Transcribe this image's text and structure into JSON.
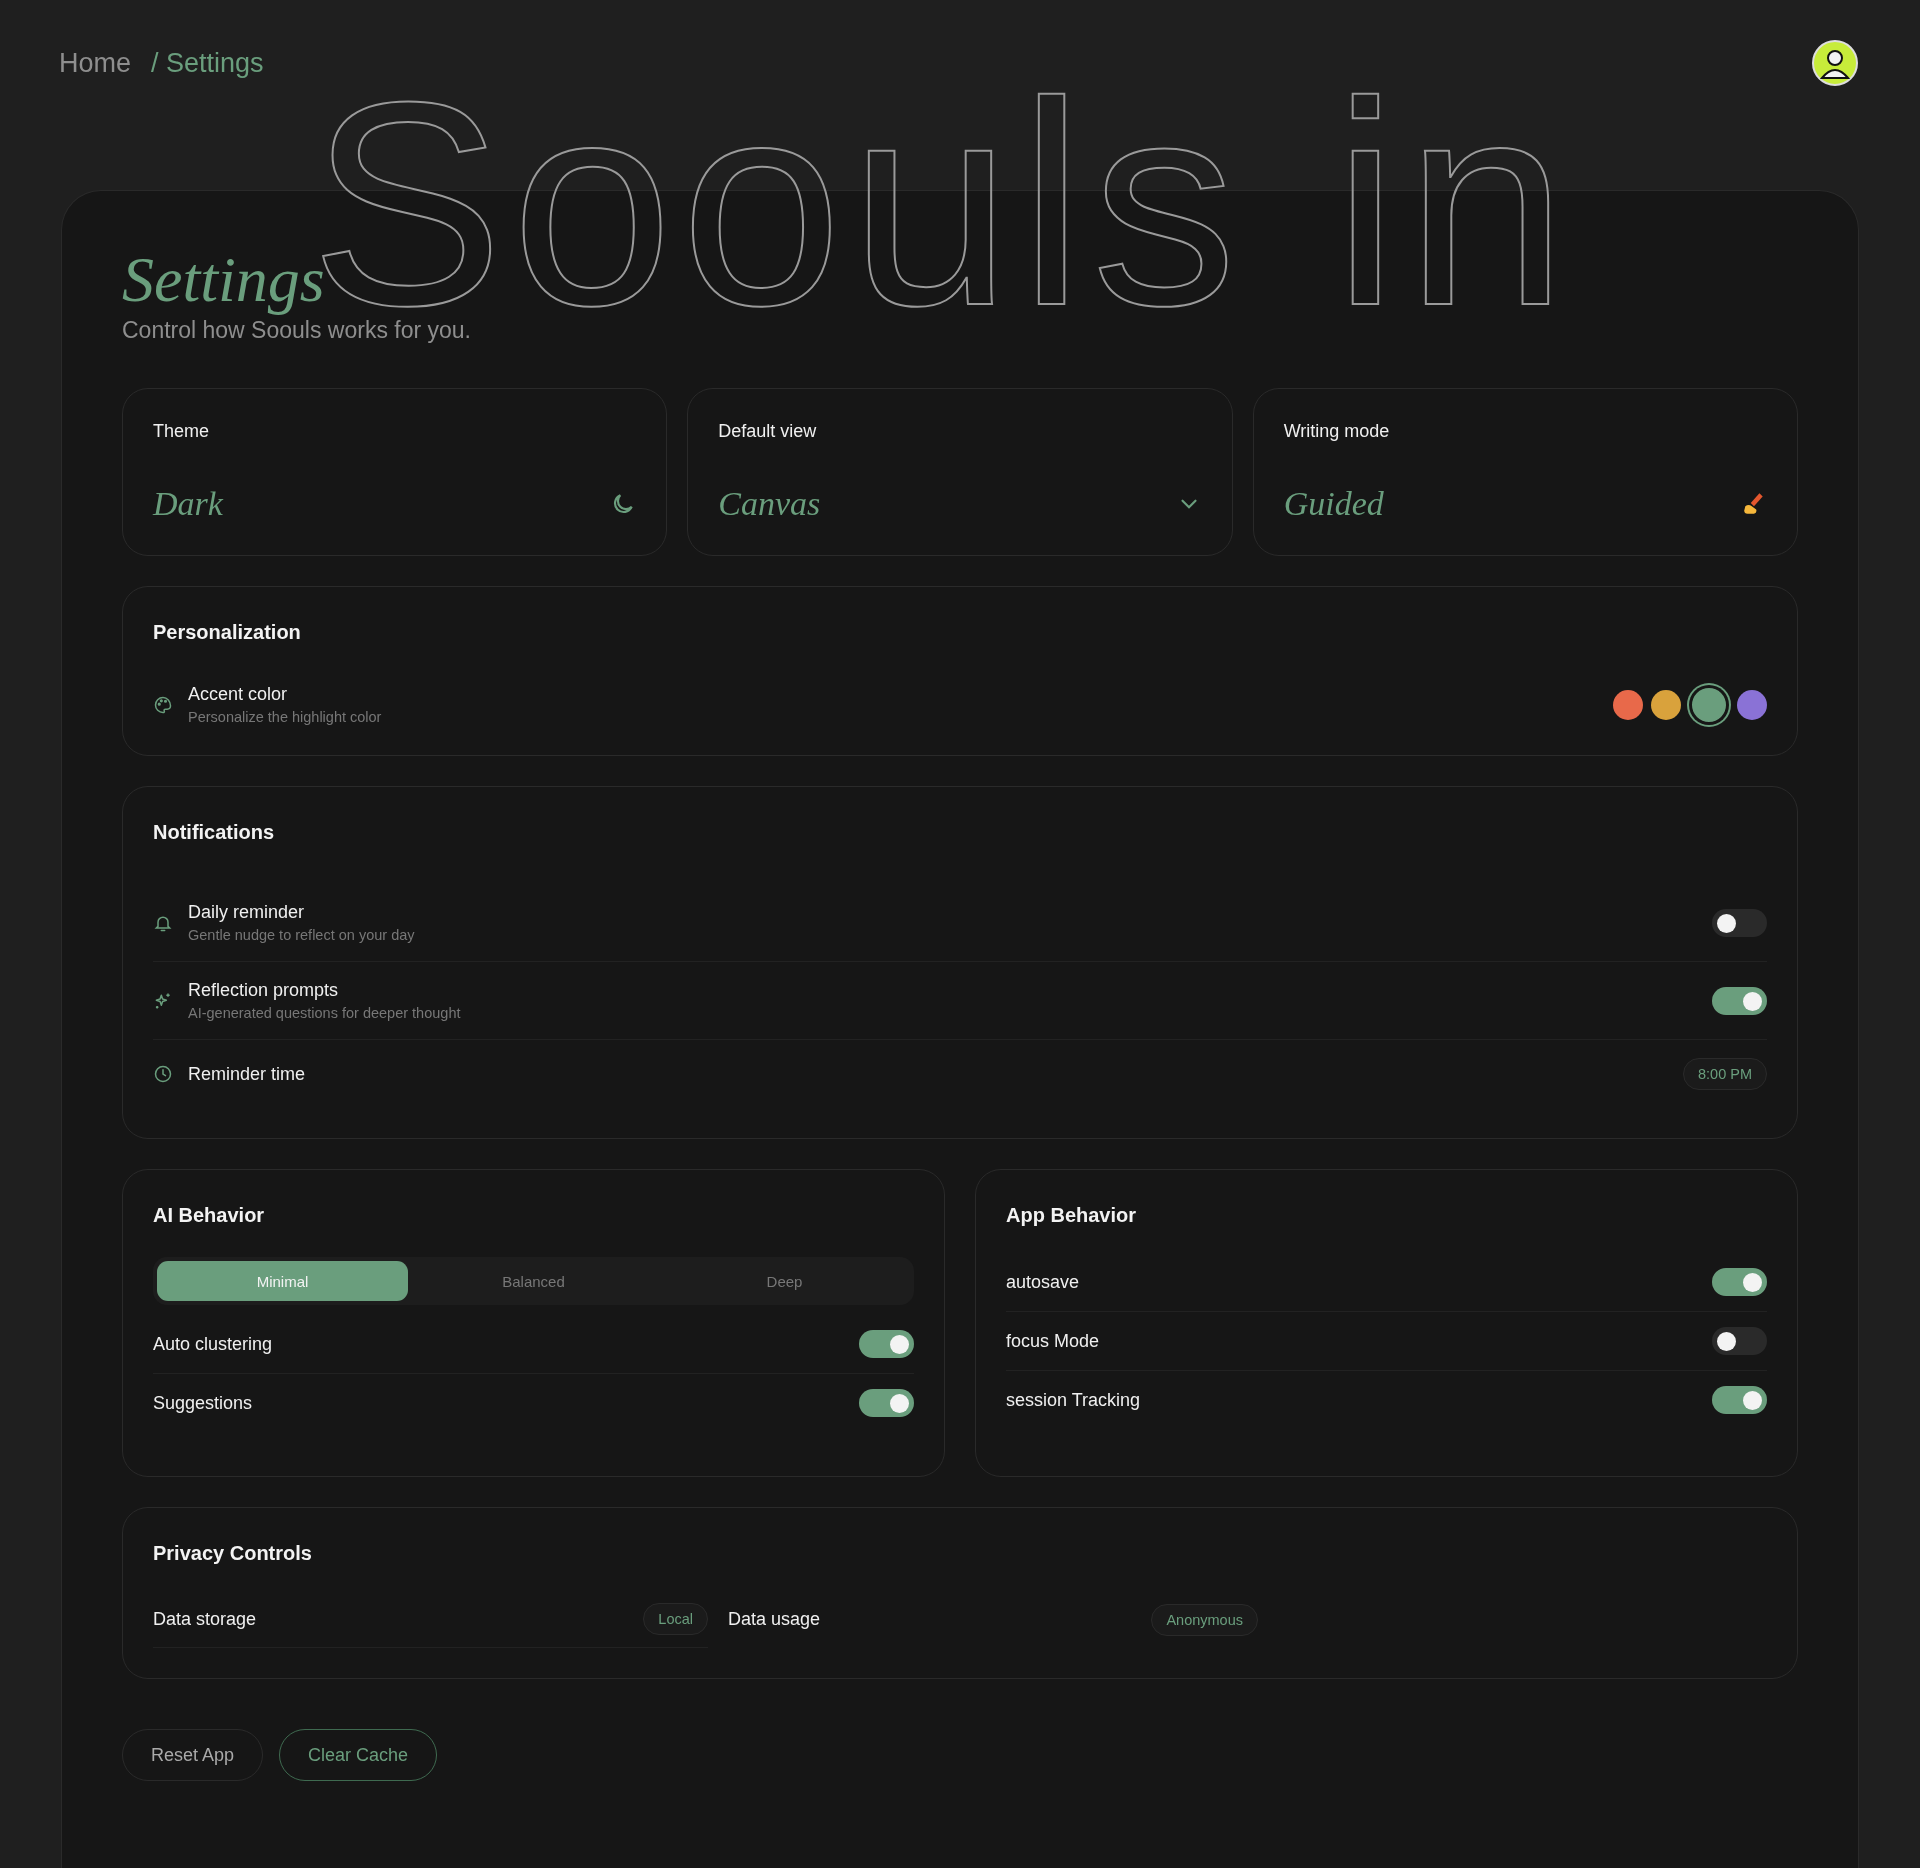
{
  "breadcrumb": [
    {
      "label": "Home",
      "current": false
    },
    {
      "label": "/ Settings",
      "current": true
    }
  ],
  "background_text": "Soouls in",
  "header": {
    "title": "Settings",
    "subtitle": "Control how Soouls works for you."
  },
  "quick_settings": [
    {
      "label": "Theme",
      "value": "Dark",
      "kind": "moon"
    },
    {
      "label": "Default view",
      "value": "Canvas",
      "kind": "dropdown"
    },
    {
      "label": "Writing mode",
      "value": "Guided",
      "kind": "hand"
    }
  ],
  "personalization": {
    "title": "Personalization",
    "label": "Accent color",
    "description": "Personalize the highlight color",
    "colors": [
      {
        "color": "#e8694a",
        "selected": false
      },
      {
        "color": "#d9a23c",
        "selected": false
      },
      {
        "color": "#6a9e7d",
        "selected": true
      },
      {
        "color": "#8a72d6",
        "selected": false
      }
    ]
  },
  "notifications": {
    "title": "Notifications",
    "rows": [
      {
        "kind": "toggle",
        "label": "Daily reminder",
        "description": "Gentle nudge to reflect on your day",
        "on": false
      },
      {
        "kind": "toggle",
        "label": "Reflection prompts",
        "description": "AI-generated questions for deeper thought",
        "on": true
      },
      {
        "kind": "time",
        "label": "Reminder time",
        "value": "8:00 PM"
      }
    ]
  },
  "ai_behavior": {
    "title": "AI Behavior",
    "modes": [
      {
        "label": "Minimal",
        "selected": true
      },
      {
        "label": "Balanced",
        "selected": false
      },
      {
        "label": "Deep",
        "selected": false
      }
    ],
    "toggles": [
      {
        "label": "Auto clustering",
        "on": true
      },
      {
        "label": "Suggestions",
        "on": true
      }
    ]
  },
  "app_behavior": {
    "title": "App Behavior",
    "toggles": [
      {
        "label": "autosave",
        "on": true
      },
      {
        "label": "focus Mode",
        "on": false
      },
      {
        "label": "session Tracking",
        "on": true
      }
    ]
  },
  "privacy": {
    "title": "Privacy Controls",
    "items": [
      {
        "label": "Data storage",
        "value": "Local"
      },
      {
        "label": "Data usage",
        "value": "Anonymous"
      }
    ]
  },
  "actions": [
    {
      "label": "Reset App",
      "kind": "neutral"
    },
    {
      "label": "Clear Cache",
      "kind": "accent"
    }
  ]
}
